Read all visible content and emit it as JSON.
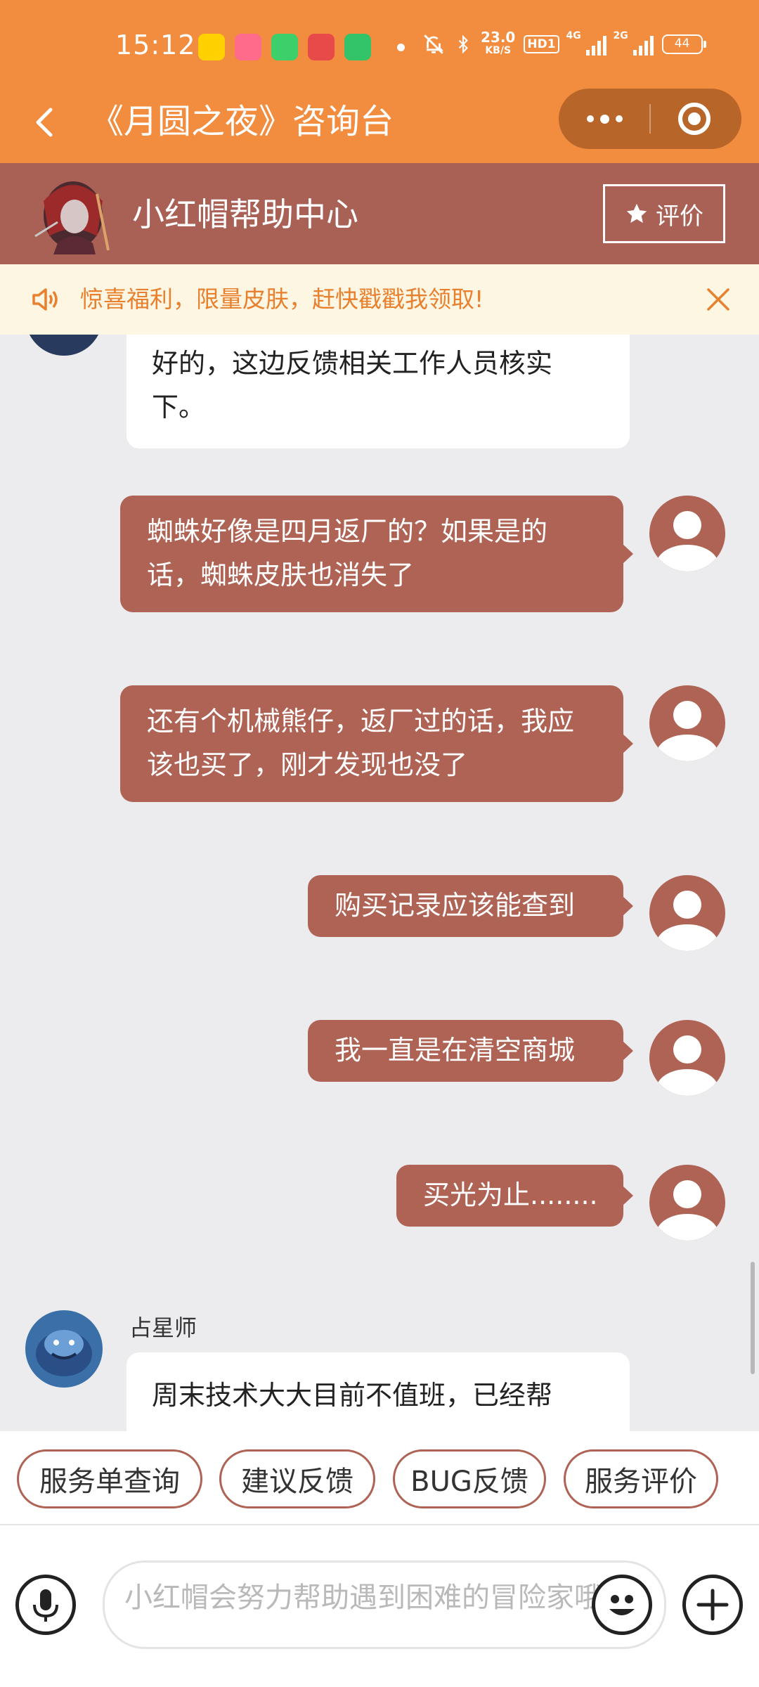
{
  "status_bar": {
    "time": "15:12",
    "net_speed": "23.0",
    "net_unit": "KB/S",
    "hd": "HD1",
    "sig1_label": "4G",
    "sig2_label": "2G",
    "battery": "44",
    "app_icons": [
      "meituan-icon",
      "game-icon",
      "chat-icon",
      "gamebox-icon",
      "music-icon"
    ]
  },
  "title_bar": {
    "title": "《月圆之夜》咨询台"
  },
  "help_header": {
    "title": "小红帽帮助中心",
    "rate_label": "评价"
  },
  "notice": {
    "text": "惊喜福利，限量皮肤，赶快戳戳我领取!"
  },
  "messages": [
    {
      "sender": "agent",
      "text": "好的，这边反馈相关工作人员核实下。"
    },
    {
      "sender": "user",
      "text": "蜘蛛好像是四月返厂的？如果是的话，蜘蛛皮肤也消失了"
    },
    {
      "sender": "user",
      "text": "还有个机械熊仔，返厂过的话，我应该也买了，刚才发现也没了"
    },
    {
      "sender": "user",
      "text": "购买记录应该能查到"
    },
    {
      "sender": "user",
      "text": "我一直是在清空商城"
    },
    {
      "sender": "user",
      "text": "买光为止........"
    },
    {
      "sender": "agent",
      "name": "占星师",
      "text": "周末技术大大目前不值班，已经帮"
    }
  ],
  "quick_replies": [
    "服务单查询",
    "建议反馈",
    "BUG反馈",
    "服务评价"
  ],
  "input": {
    "placeholder": "小红帽会努力帮助遇到困难的冒险家哦~"
  },
  "colors": {
    "orange": "#f28c3f",
    "brown": "#a96156",
    "bubble_user": "#ae6355",
    "notice_text": "#e8802e"
  }
}
